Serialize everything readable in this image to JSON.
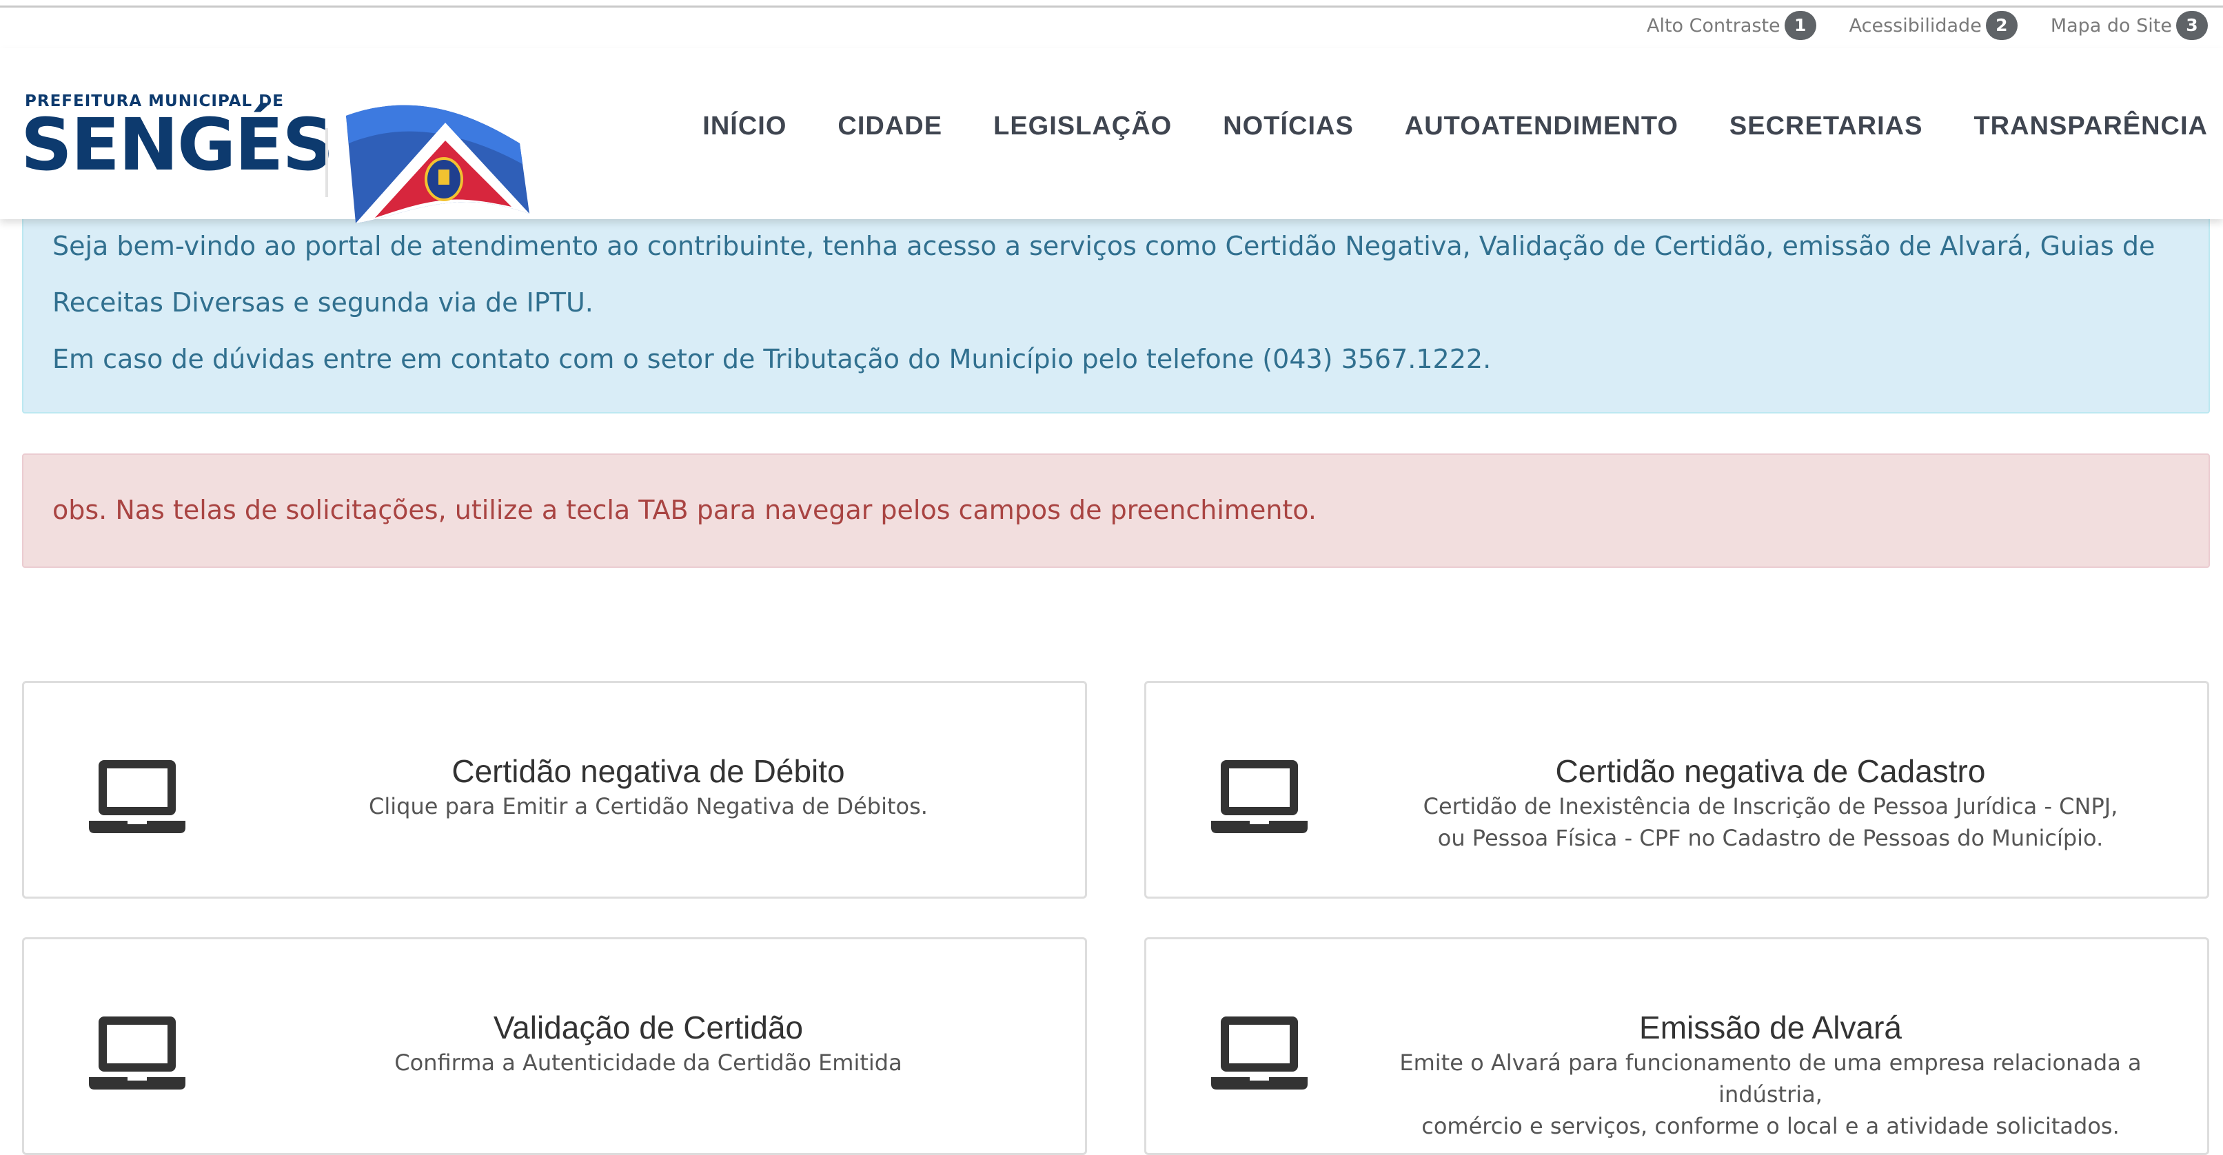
{
  "access_bar": {
    "items": [
      {
        "label": "Alto Contraste",
        "key": "1"
      },
      {
        "label": "Acessibilidade",
        "key": "2"
      },
      {
        "label": "Mapa do Site",
        "key": "3"
      }
    ]
  },
  "logo": {
    "line1": "PREFEITURA MUNICIPAL DE",
    "line2": "SENGÉS",
    "flag_icon": "municipal-flag"
  },
  "nav": {
    "items": [
      "INÍCIO",
      "CIDADE",
      "LEGISLAÇÃO",
      "NOTÍCIAS",
      "AUTOATENDIMENTO",
      "SECRETARIAS",
      "TRANSPARÊNCIA"
    ]
  },
  "info_alert": {
    "paragraph1": "Seja bem-vindo ao portal de atendimento ao contribuinte, tenha acesso a serviços como Certidão Negativa, Validação de Certidão, emissão de Alvará, Guias de Receitas Diversas e segunda via de IPTU.",
    "paragraph2": "Em caso de dúvidas entre em contato com o setor de Tributação do Município pelo telefone (043) 3567.1222."
  },
  "warning_alert": {
    "text": "obs. Nas telas de solicitações, utilize a tecla TAB para navegar pelos campos de preenchimento."
  },
  "services": [
    {
      "title": "Certidão negativa de Débito",
      "desc_line1": "Clique para Emitir a Certidão Negativa de Débitos.",
      "desc_line2": "",
      "icon": "laptop-icon"
    },
    {
      "title": "Certidão negativa de Cadastro",
      "desc_line1": "Certidão de Inexistência de Inscrição de Pessoa Jurídica - CNPJ,",
      "desc_line2": "ou Pessoa Física - CPF no Cadastro de Pessoas do Município.",
      "icon": "laptop-icon"
    },
    {
      "title": "Validação de Certidão",
      "desc_line1": "Confirma a Autenticidade da Certidão Emitida",
      "desc_line2": "",
      "icon": "laptop-icon"
    },
    {
      "title": "Emissão de Alvará",
      "desc_line1": "Emite o Alvará para funcionamento de uma empresa relacionada a indústria,",
      "desc_line2": "comércio e serviços, conforme o local e a atividade solicitados.",
      "icon": "laptop-icon"
    }
  ],
  "colors": {
    "brand_blue": "#0d3a6e",
    "info_bg": "#d9edf7",
    "info_text": "#31708f",
    "danger_bg": "#f2dede",
    "danger_text": "#a94442",
    "badge_bg": "#5f6367"
  }
}
